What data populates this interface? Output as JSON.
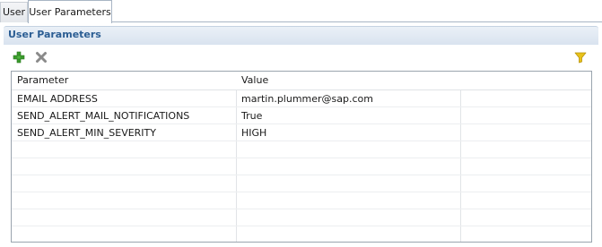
{
  "tabs": [
    {
      "label": "User",
      "active": false
    },
    {
      "label": "User Parameters",
      "active": true
    }
  ],
  "section": {
    "title": "User Parameters"
  },
  "toolbar": {
    "add_icon": "add-icon",
    "delete_icon": "delete-icon",
    "filter_icon": "filter-icon"
  },
  "table": {
    "columns": [
      "Parameter",
      "Value",
      ""
    ],
    "rows": [
      {
        "parameter": "EMAIL ADDRESS",
        "value": "martin.plummer@sap.com"
      },
      {
        "parameter": "SEND_ALERT_MAIL_NOTIFICATIONS",
        "value": "True"
      },
      {
        "parameter": "SEND_ALERT_MIN_SEVERITY",
        "value": "HIGH"
      },
      {
        "parameter": "",
        "value": ""
      },
      {
        "parameter": "",
        "value": ""
      },
      {
        "parameter": "",
        "value": ""
      },
      {
        "parameter": "",
        "value": ""
      },
      {
        "parameter": "",
        "value": ""
      },
      {
        "parameter": "",
        "value": ""
      }
    ]
  },
  "colors": {
    "section_title": "#2b5d93",
    "header_bg": "#d9e3ef",
    "add_green": "#3a9a2c",
    "delete_gray": "#8a8a8a",
    "filter_yellow": "#e8c21a"
  }
}
